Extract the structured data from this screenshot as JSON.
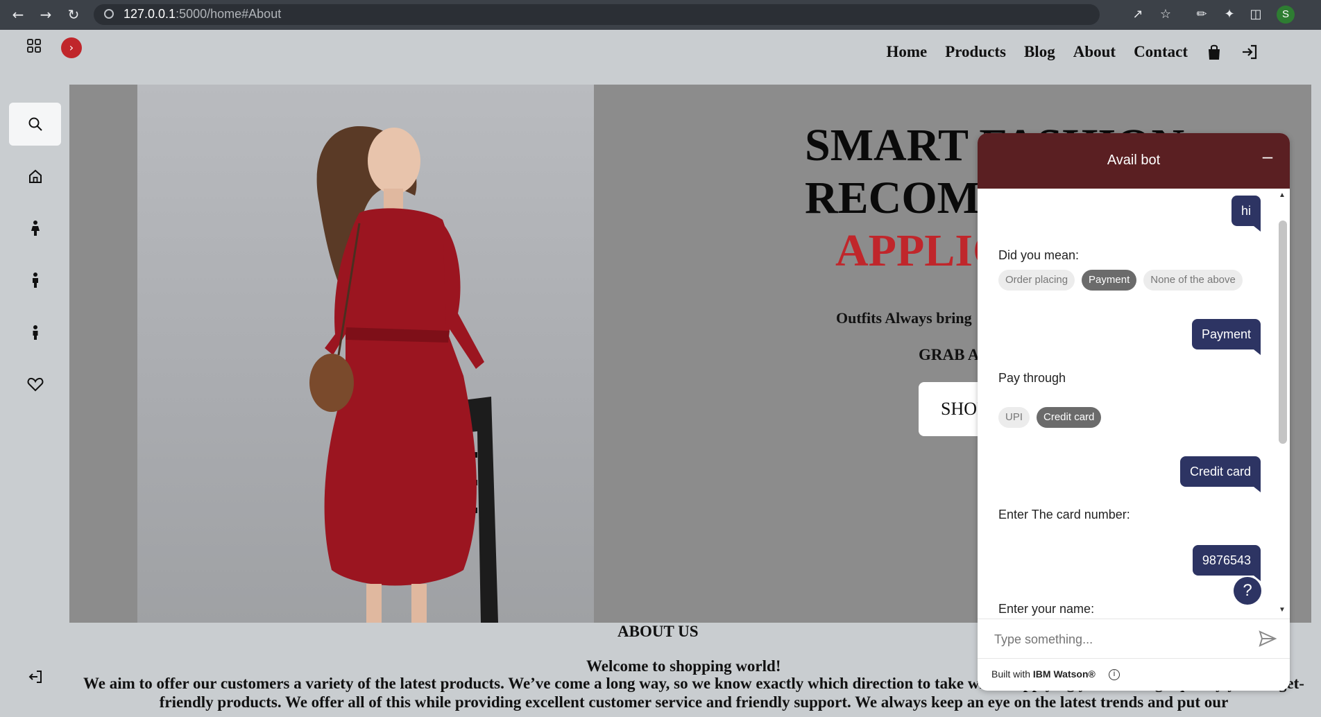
{
  "browser": {
    "url_host": "127.0.0.1",
    "url_path": ":5000/home#About",
    "profile_initial": "S",
    "icons": [
      "back-icon",
      "forward-icon",
      "reload-icon",
      "share-icon",
      "star-icon",
      "pen-icon",
      "extensions-icon",
      "sidepanel-icon"
    ]
  },
  "sidebar": {
    "items": [
      "search-icon",
      "home-icon",
      "woman-icon",
      "man-icon",
      "kid-icon",
      "heart-icon",
      "logout-icon"
    ]
  },
  "nav": {
    "items": [
      "Home",
      "Products",
      "Blog",
      "About",
      "Contact"
    ]
  },
  "hero": {
    "title_line1": "SMART FASHION",
    "title_line2": "RECOMMENDER",
    "title_line3": "APPLICATION",
    "subtitle": "Outfits Always bring",
    "grab": "GRAB A",
    "button": "SHOP"
  },
  "about": {
    "heading": "ABOUT US",
    "welcome": "Welcome to shopping world!",
    "paragraph": "We aim to offer our customers a variety of the latest products. We’ve come a long way, so we know exactly which direction to take when supplying you with high quality yet budget-friendly products. We offer all of this while providing excellent customer service and friendly support. We always keep an eye on the latest trends and put our"
  },
  "chat": {
    "title": "Avail bot",
    "messages": {
      "user_hi": "hi",
      "bot_did_you_mean": "Did you mean:",
      "chips1": [
        "Order placing",
        "Payment",
        "None of the above"
      ],
      "user_payment": "Payment",
      "bot_pay_through": "Pay through",
      "chips2": [
        "UPI",
        "Credit card"
      ],
      "user_credit": "Credit card",
      "bot_card_number": "Enter The card number:",
      "user_card": "9876543",
      "bot_name": "Enter your name:"
    },
    "input_placeholder": "Type something...",
    "footer_prefix": "Built with ",
    "footer_brand": "IBM Watson®",
    "help": "?"
  },
  "colors": {
    "accent_red": "#c0262b",
    "chat_header": "#5a1f22",
    "user_bubble": "#2d3463"
  }
}
